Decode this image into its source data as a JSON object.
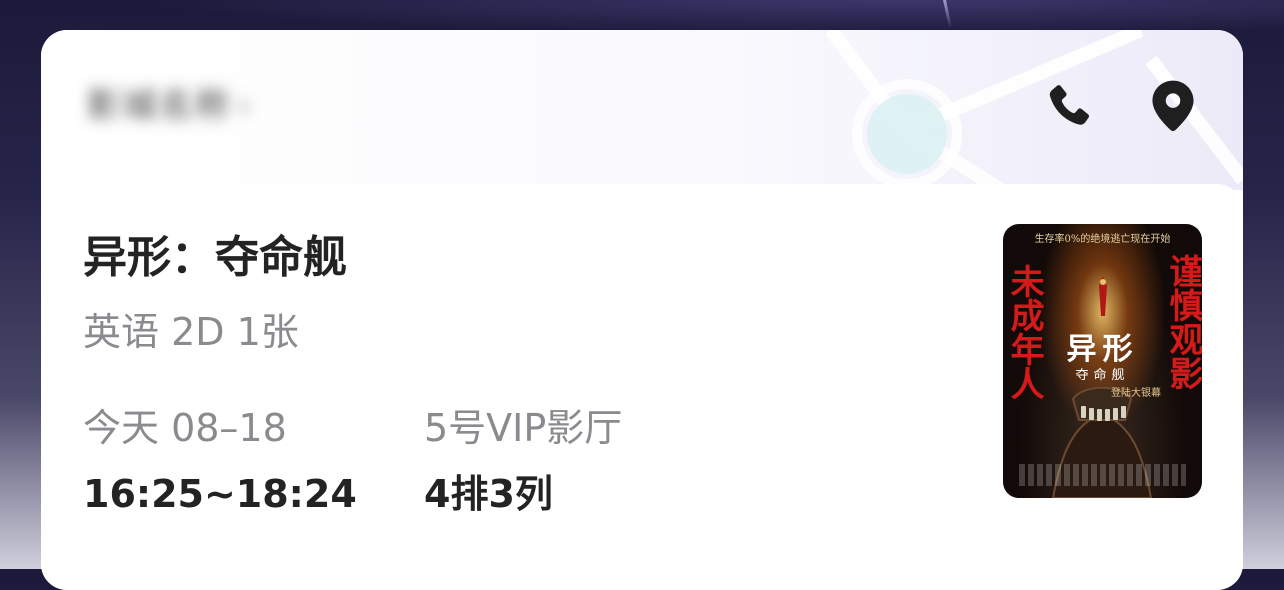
{
  "header": {
    "cinema_name": "影城名称",
    "chevron": "›",
    "phone_icon": "phone-icon",
    "location_icon": "location-pin-icon"
  },
  "ticket": {
    "title": "异形：夺命舰",
    "subtitle": "英语 2D 1张",
    "date_label": "今天 08–18",
    "time_value": "16:25~18:24",
    "hall_label": "5号VIP影厅",
    "seat_value": "4排3列"
  },
  "poster": {
    "top_line": "生存率0%的绝境逃亡现在开始",
    "left_text": "未成年人",
    "right_text": "谨慎观影",
    "title": "异形",
    "subtitle": "夺命舰",
    "tagline": "登陆大银幕"
  },
  "colors": {
    "card_bg": "#ffffff",
    "primary_text": "#232323",
    "secondary_text": "#8a8a8f",
    "poster_red": "#d51a1a"
  }
}
